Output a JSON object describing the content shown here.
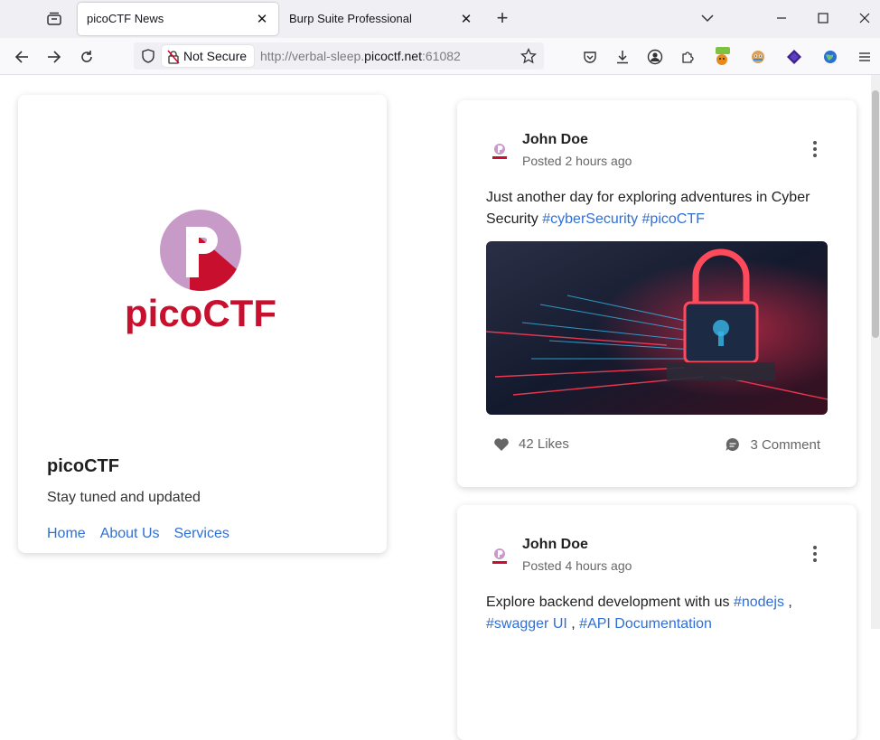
{
  "browser": {
    "tabs": [
      {
        "title": "picoCTF News"
      },
      {
        "title": "Burp Suite Professional"
      }
    ],
    "security_label": "Not Secure",
    "url_prefix": "http://verbal-sleep.",
    "url_domain": "picoctf.net",
    "url_suffix": ":61082"
  },
  "profile": {
    "logo_text": "picoCTF",
    "name": "picoCTF",
    "tagline": "Stay tuned and updated",
    "links": [
      "Home",
      "About Us",
      "Services"
    ]
  },
  "posts": [
    {
      "author": "John Doe",
      "posted": "Posted 2 hours ago",
      "text": "Just another day for exploring adventures in Cyber Security ",
      "hashtags": [
        "#cyberSecurity",
        "#picoCTF"
      ],
      "likes": "42 Likes",
      "comments": "3 Comment"
    },
    {
      "author": "John Doe",
      "posted": "Posted 4 hours ago",
      "text": "Explore backend development with us ",
      "hashtags": [
        "#nodejs",
        "#swagger UI",
        "#API Documentation"
      ]
    }
  ],
  "colors": {
    "brand_red": "#c8102e",
    "brand_purple": "#c79ac7",
    "link_blue": "#2f6fd6"
  }
}
